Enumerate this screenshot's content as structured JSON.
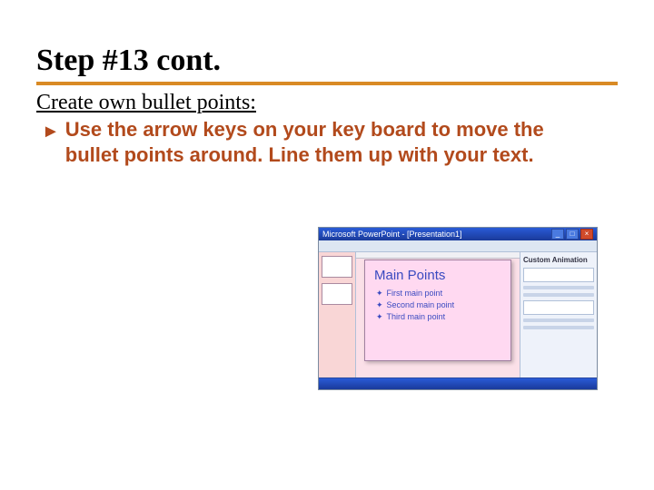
{
  "title": "Step #13 cont.",
  "subheading": "Create own bullet points:",
  "bullet_marker": "►",
  "bullet_text": "Use the arrow keys on your key board to move the bullet points around. Line them up with your text.",
  "accent_color": "#d98a24",
  "bullet_color": "#b24a1c",
  "embedded": {
    "app_title": "Microsoft PowerPoint - [Presentation1]",
    "slide_title": "Main Points",
    "points": [
      "First main point",
      "Second main point",
      "Third main point"
    ],
    "taskpane_title": "Custom Animation"
  }
}
